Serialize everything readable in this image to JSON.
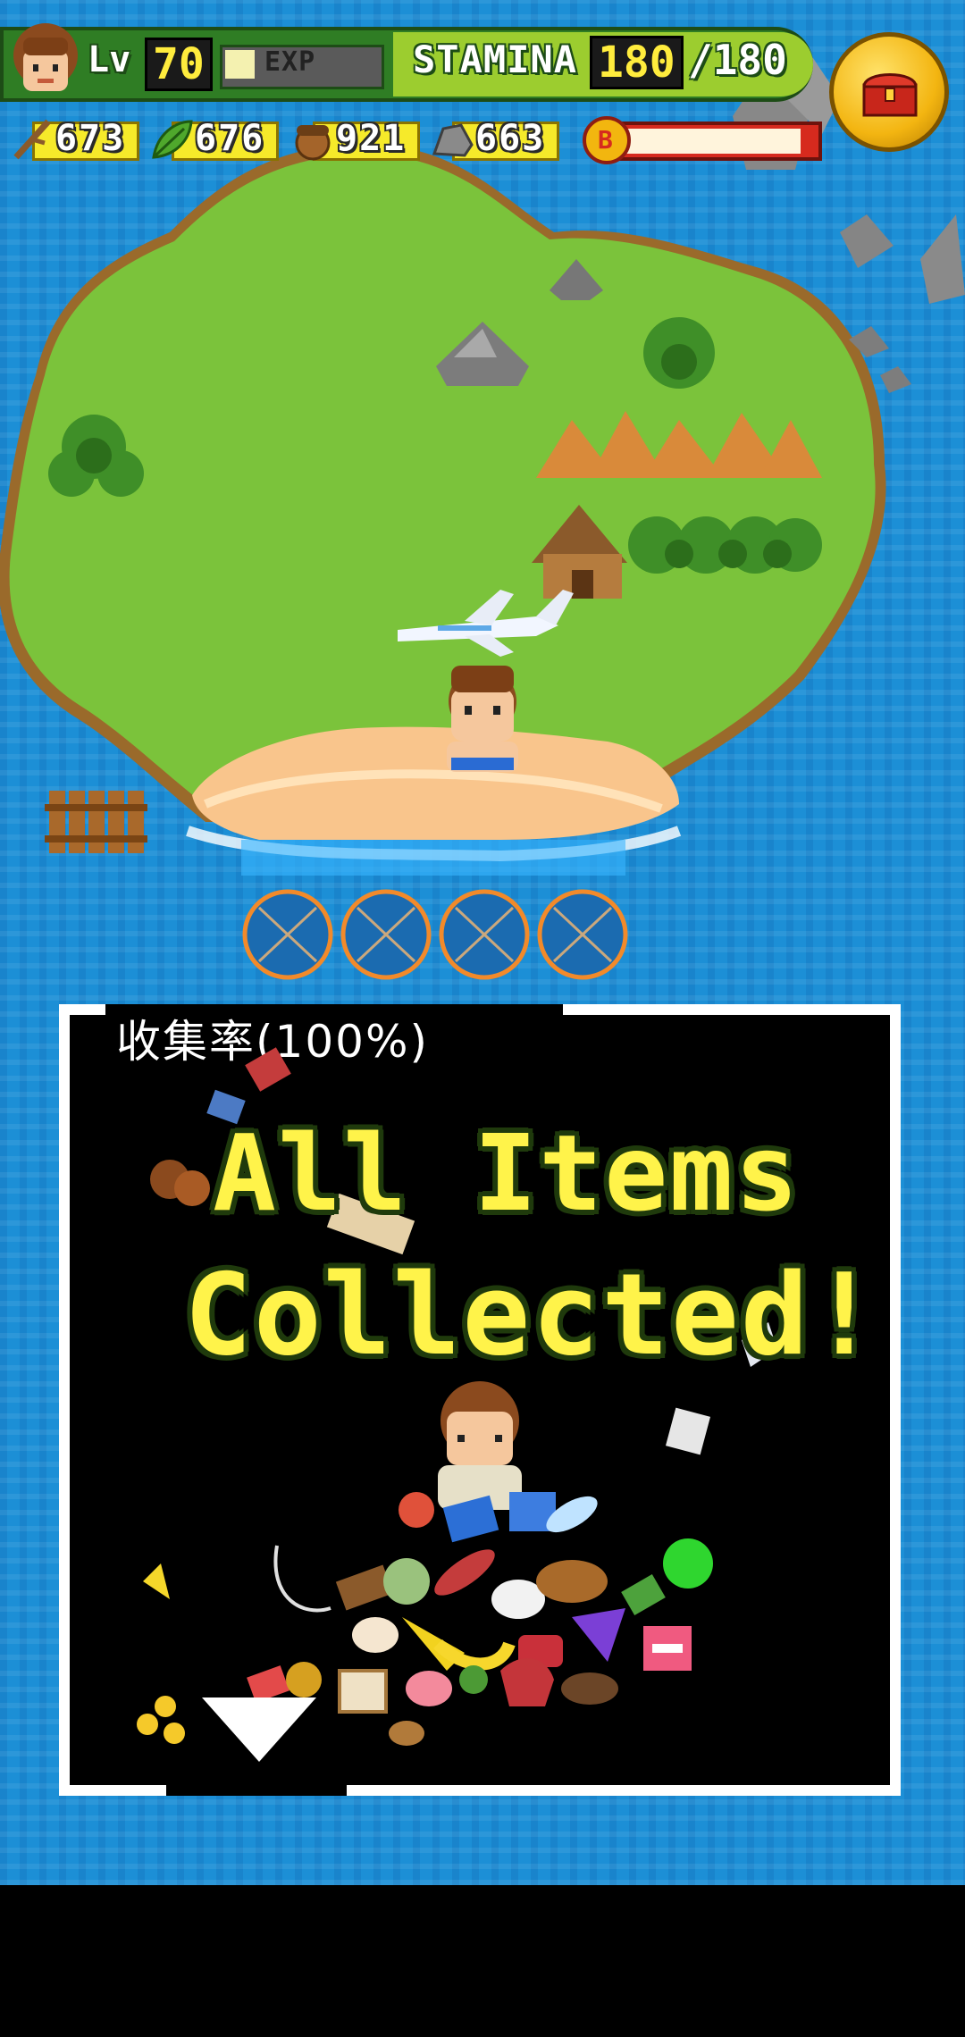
{
  "hud": {
    "level_label": "Lv",
    "level": "70",
    "exp_label": "EXP",
    "exp_fraction": 0.2,
    "stamina_label": "STAMINA",
    "stamina": "180",
    "stamina_max": "/180"
  },
  "resources": [
    {
      "name": "branch",
      "value": "673"
    },
    {
      "name": "leaf",
      "value": "676"
    },
    {
      "name": "nut",
      "value": "921"
    },
    {
      "name": "stone",
      "value": "663"
    }
  ],
  "boost": {
    "icon_letter": "B",
    "fill_fraction": 1.0
  },
  "panel": {
    "title": "收集率(100%)",
    "message_line1": "All Items",
    "message_line2": "Collected!"
  },
  "colors": {
    "sea": "#1c8fd6",
    "grass": "#7bc33b",
    "sand": "#f9c58c",
    "message_yellow": "#fff34a",
    "hud_green": "#2f7d24"
  }
}
